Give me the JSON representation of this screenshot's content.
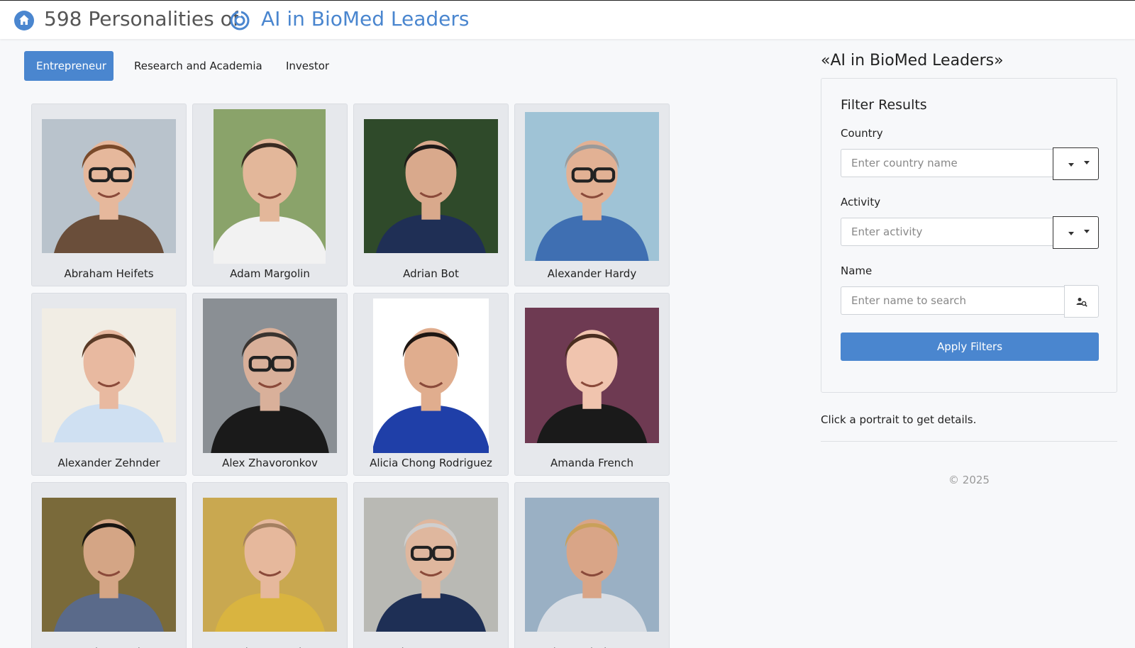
{
  "header": {
    "count_title": "598 Personalities of",
    "brand_title": "AI in BioMed Leaders",
    "home_icon": "home-icon",
    "brand_icon": "brand-logo-icon",
    "accent_color": "#4a86cf"
  },
  "tabs": [
    {
      "label": "Entrepreneur",
      "active": true
    },
    {
      "label": "Research and Academia",
      "active": false
    },
    {
      "label": "Investor",
      "active": false
    }
  ],
  "cards": [
    {
      "name": "Abraham Heifets",
      "bg": "#b9c3cc",
      "skin": "#e6b89c",
      "hair": "#7a4a2a",
      "shirt": "#6a4e3a",
      "glasses": true
    },
    {
      "name": "Adam Margolin",
      "bg": "#8aa36a",
      "skin": "#e3b79a",
      "hair": "#3a2c22",
      "shirt": "#f2f2f2",
      "glasses": false
    },
    {
      "name": "Adrian Bot",
      "bg": "#2f4a2a",
      "skin": "#d9a98c",
      "hair": "#1e1a18",
      "shirt": "#1f2f55",
      "glasses": false
    },
    {
      "name": "Alexander Hardy",
      "bg": "#9fc3d6",
      "skin": "#e2b194",
      "hair": "#9a9a9a",
      "shirt": "#3f6fb2",
      "glasses": true
    },
    {
      "name": "Alexander Zehnder",
      "bg": "#f1ede4",
      "skin": "#e8b9a0",
      "hair": "#5a3a26",
      "shirt": "#cfe0f2",
      "glasses": false
    },
    {
      "name": "Alex Zhavoronkov",
      "bg": "#8a8f94",
      "skin": "#d9b09a",
      "hair": "#3a3430",
      "shirt": "#1a1a1a",
      "glasses": true
    },
    {
      "name": "Alicia Chong Rodriguez",
      "bg": "#ffffff",
      "skin": "#e0ad8e",
      "hair": "#1e1612",
      "shirt": "#1f3fa8",
      "glasses": false
    },
    {
      "name": "Amanda French",
      "bg": "#6e3a52",
      "skin": "#f0c4ae",
      "hair": "#4a2e20",
      "shirt": "#1a1a1a",
      "glasses": false
    },
    {
      "name": "Amir Haveri",
      "bg": "#7a6a3a",
      "skin": "#d4a585",
      "hair": "#1a1612",
      "shirt": "#5a6a8a",
      "glasses": false
    },
    {
      "name": "Andreas Bender",
      "bg": "#c9a850",
      "skin": "#e6b89c",
      "hair": "#a58060",
      "shirt": "#d9b440",
      "glasses": false
    },
    {
      "name": "Andreas Mattsson",
      "bg": "#b9b9b4",
      "skin": "#dfb79e",
      "hair": "#cfcfcf",
      "shirt": "#1e2f55",
      "glasses": true
    },
    {
      "name": "Andreas Niethammer",
      "bg": "#9ab0c4",
      "skin": "#d9a587",
      "hair": "#c9a05a",
      "shirt": "#d8dde4",
      "glasses": false
    }
  ],
  "sidebar": {
    "title": "«AI in BioMed Leaders»",
    "filter_heading": "Filter Results",
    "country_label": "Country",
    "country_placeholder": "Enter country name",
    "activity_label": "Activity",
    "activity_placeholder": "Enter activity",
    "name_label": "Name",
    "name_placeholder": "Enter name to search",
    "apply_label": "Apply Filters",
    "hint": "Click a portrait to get details.",
    "copyright": "© 2025"
  }
}
